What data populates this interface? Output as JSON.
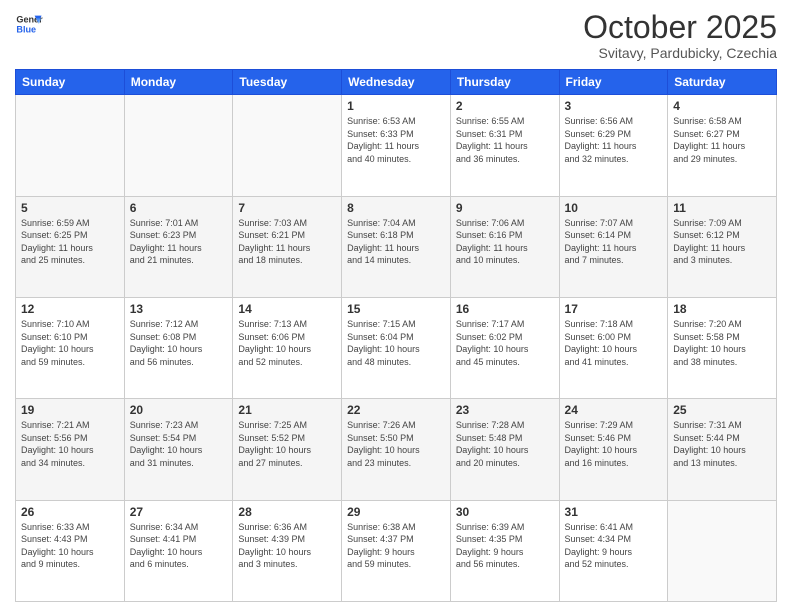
{
  "header": {
    "logo_line1": "General",
    "logo_line2": "Blue",
    "title": "October 2025",
    "subtitle": "Svitavy, Pardubicky, Czechia"
  },
  "weekdays": [
    "Sunday",
    "Monday",
    "Tuesday",
    "Wednesday",
    "Thursday",
    "Friday",
    "Saturday"
  ],
  "weeks": [
    [
      {
        "day": "",
        "info": ""
      },
      {
        "day": "",
        "info": ""
      },
      {
        "day": "",
        "info": ""
      },
      {
        "day": "1",
        "info": "Sunrise: 6:53 AM\nSunset: 6:33 PM\nDaylight: 11 hours\nand 40 minutes."
      },
      {
        "day": "2",
        "info": "Sunrise: 6:55 AM\nSunset: 6:31 PM\nDaylight: 11 hours\nand 36 minutes."
      },
      {
        "day": "3",
        "info": "Sunrise: 6:56 AM\nSunset: 6:29 PM\nDaylight: 11 hours\nand 32 minutes."
      },
      {
        "day": "4",
        "info": "Sunrise: 6:58 AM\nSunset: 6:27 PM\nDaylight: 11 hours\nand 29 minutes."
      }
    ],
    [
      {
        "day": "5",
        "info": "Sunrise: 6:59 AM\nSunset: 6:25 PM\nDaylight: 11 hours\nand 25 minutes."
      },
      {
        "day": "6",
        "info": "Sunrise: 7:01 AM\nSunset: 6:23 PM\nDaylight: 11 hours\nand 21 minutes."
      },
      {
        "day": "7",
        "info": "Sunrise: 7:03 AM\nSunset: 6:21 PM\nDaylight: 11 hours\nand 18 minutes."
      },
      {
        "day": "8",
        "info": "Sunrise: 7:04 AM\nSunset: 6:18 PM\nDaylight: 11 hours\nand 14 minutes."
      },
      {
        "day": "9",
        "info": "Sunrise: 7:06 AM\nSunset: 6:16 PM\nDaylight: 11 hours\nand 10 minutes."
      },
      {
        "day": "10",
        "info": "Sunrise: 7:07 AM\nSunset: 6:14 PM\nDaylight: 11 hours\nand 7 minutes."
      },
      {
        "day": "11",
        "info": "Sunrise: 7:09 AM\nSunset: 6:12 PM\nDaylight: 11 hours\nand 3 minutes."
      }
    ],
    [
      {
        "day": "12",
        "info": "Sunrise: 7:10 AM\nSunset: 6:10 PM\nDaylight: 10 hours\nand 59 minutes."
      },
      {
        "day": "13",
        "info": "Sunrise: 7:12 AM\nSunset: 6:08 PM\nDaylight: 10 hours\nand 56 minutes."
      },
      {
        "day": "14",
        "info": "Sunrise: 7:13 AM\nSunset: 6:06 PM\nDaylight: 10 hours\nand 52 minutes."
      },
      {
        "day": "15",
        "info": "Sunrise: 7:15 AM\nSunset: 6:04 PM\nDaylight: 10 hours\nand 48 minutes."
      },
      {
        "day": "16",
        "info": "Sunrise: 7:17 AM\nSunset: 6:02 PM\nDaylight: 10 hours\nand 45 minutes."
      },
      {
        "day": "17",
        "info": "Sunrise: 7:18 AM\nSunset: 6:00 PM\nDaylight: 10 hours\nand 41 minutes."
      },
      {
        "day": "18",
        "info": "Sunrise: 7:20 AM\nSunset: 5:58 PM\nDaylight: 10 hours\nand 38 minutes."
      }
    ],
    [
      {
        "day": "19",
        "info": "Sunrise: 7:21 AM\nSunset: 5:56 PM\nDaylight: 10 hours\nand 34 minutes."
      },
      {
        "day": "20",
        "info": "Sunrise: 7:23 AM\nSunset: 5:54 PM\nDaylight: 10 hours\nand 31 minutes."
      },
      {
        "day": "21",
        "info": "Sunrise: 7:25 AM\nSunset: 5:52 PM\nDaylight: 10 hours\nand 27 minutes."
      },
      {
        "day": "22",
        "info": "Sunrise: 7:26 AM\nSunset: 5:50 PM\nDaylight: 10 hours\nand 23 minutes."
      },
      {
        "day": "23",
        "info": "Sunrise: 7:28 AM\nSunset: 5:48 PM\nDaylight: 10 hours\nand 20 minutes."
      },
      {
        "day": "24",
        "info": "Sunrise: 7:29 AM\nSunset: 5:46 PM\nDaylight: 10 hours\nand 16 minutes."
      },
      {
        "day": "25",
        "info": "Sunrise: 7:31 AM\nSunset: 5:44 PM\nDaylight: 10 hours\nand 13 minutes."
      }
    ],
    [
      {
        "day": "26",
        "info": "Sunrise: 6:33 AM\nSunset: 4:43 PM\nDaylight: 10 hours\nand 9 minutes."
      },
      {
        "day": "27",
        "info": "Sunrise: 6:34 AM\nSunset: 4:41 PM\nDaylight: 10 hours\nand 6 minutes."
      },
      {
        "day": "28",
        "info": "Sunrise: 6:36 AM\nSunset: 4:39 PM\nDaylight: 10 hours\nand 3 minutes."
      },
      {
        "day": "29",
        "info": "Sunrise: 6:38 AM\nSunset: 4:37 PM\nDaylight: 9 hours\nand 59 minutes."
      },
      {
        "day": "30",
        "info": "Sunrise: 6:39 AM\nSunset: 4:35 PM\nDaylight: 9 hours\nand 56 minutes."
      },
      {
        "day": "31",
        "info": "Sunrise: 6:41 AM\nSunset: 4:34 PM\nDaylight: 9 hours\nand 52 minutes."
      },
      {
        "day": "",
        "info": ""
      }
    ]
  ]
}
